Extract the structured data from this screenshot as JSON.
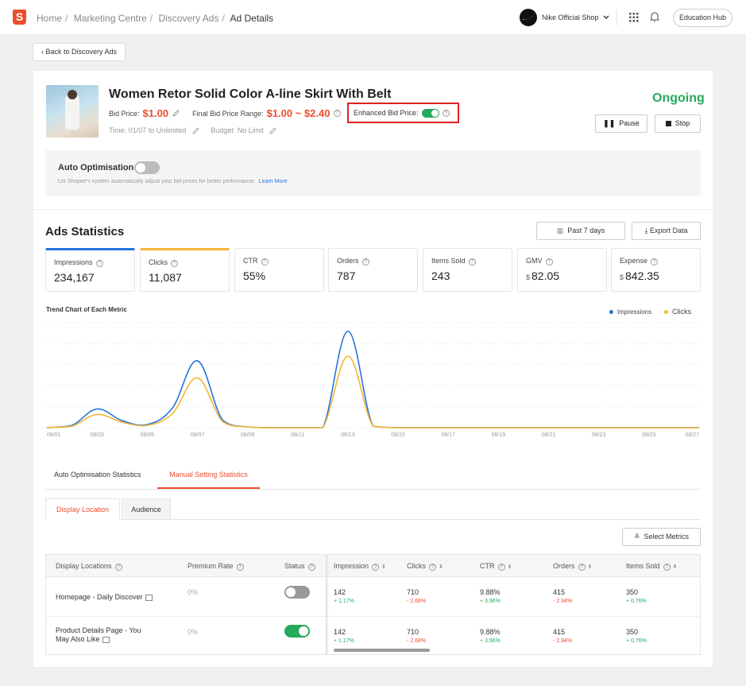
{
  "topbar": {
    "logo_letter": "S",
    "breadcrumb": [
      "Home",
      "Marketing Centre",
      "Discovery Ads",
      "Ad Details"
    ],
    "shop_name": "Nike Official Shop",
    "education_hub": "Education Hub"
  },
  "back_label": "Back to Discovery Ads",
  "product": {
    "title": "Women Retor Solid Color A-line Skirt With Belt",
    "bid_price_label": "Bid Price:",
    "bid_price": "$1.00",
    "final_range_label": "Final Bid Price Range:",
    "final_range": "$1.00 ~ $2.40",
    "enhanced_label": "Enhanced Bid Price:",
    "enhanced_on": true,
    "time": "Time: 01/07 to Unlimited",
    "budget": "Budget: No Limit",
    "status": "Ongoing",
    "pause_label": "Pause",
    "stop_label": "Stop"
  },
  "auto_opt": {
    "title": "Auto Optimisation",
    "enabled": false,
    "desc": "Let Shopee's system automatically adjust your bid prices for better performance.",
    "learn_more": "Learn More"
  },
  "stats": {
    "title": "Ads Statistics",
    "date_range": "Past 7 days",
    "export_label": "Export Data",
    "metrics": [
      {
        "label": "Impressions",
        "value": "234,167",
        "currency": ""
      },
      {
        "label": "Clicks",
        "value": "11,087",
        "currency": ""
      },
      {
        "label": "CTR",
        "value": "55%",
        "currency": ""
      },
      {
        "label": "Orders",
        "value": "787",
        "currency": ""
      },
      {
        "label": "Items Sold",
        "value": "243",
        "currency": ""
      },
      {
        "label": "GMV",
        "value": "82.05",
        "currency": "$"
      },
      {
        "label": "Expense",
        "value": "842.35",
        "currency": "$"
      }
    ],
    "trend_title": "Trend Chart of Each Metric"
  },
  "colors": {
    "impressions": "#2673dd",
    "clicks": "#f4b536",
    "accent": "#ee4d2d",
    "green": "#26aa5e"
  },
  "chart_data": {
    "type": "line",
    "x": [
      "08/01",
      "08/02",
      "08/03",
      "08/04",
      "08/05",
      "08/06",
      "08/07",
      "08/08",
      "08/09",
      "08/10",
      "08/11",
      "08/12",
      "08/13",
      "08/14",
      "08/15",
      "08/16",
      "08/17",
      "08/18",
      "08/19",
      "08/20",
      "08/21",
      "08/22",
      "08/23",
      "08/24",
      "08/25",
      "08/26",
      "08/27"
    ],
    "x_tick_labels": [
      "08/01",
      "08/03",
      "08/05",
      "08/07",
      "08/09",
      "08/11",
      "08/13",
      "08/15",
      "08/17",
      "08/19",
      "08/21",
      "08/23",
      "08/25",
      "08/27"
    ],
    "series": [
      {
        "name": "Impressions",
        "values": [
          0,
          3,
          24,
          9,
          4,
          25,
          86,
          10,
          1,
          0,
          0,
          0,
          124,
          2,
          0,
          0,
          0,
          0,
          0,
          0,
          0,
          0,
          0,
          0,
          0,
          0,
          0
        ]
      },
      {
        "name": "Clicks",
        "values": [
          0,
          2,
          17,
          7,
          3,
          18,
          64,
          8,
          1,
          0,
          0,
          0,
          92,
          2,
          0,
          0,
          0,
          0,
          0,
          0,
          0,
          0,
          0,
          0,
          0,
          0,
          0
        ]
      }
    ],
    "ylim": [
      0,
      135
    ],
    "grid": true,
    "legend": "top-right"
  },
  "tabs": [
    "Auto Optimisation Statistics",
    "Manual Setting Statistics"
  ],
  "subtabs": [
    "Display Location",
    "Audience"
  ],
  "select_metrics": "Select Metrics",
  "table": {
    "headers": [
      "Display Locations",
      "Premium Rate",
      "Status",
      "Impression",
      "Clicks",
      "CTR",
      "Orders",
      "Items Sold"
    ],
    "rows": [
      {
        "location": "Homepage - Daily Discover",
        "premium": "0%",
        "status_on": false,
        "impression": "142",
        "impression_delta": "+ 1.17%",
        "clicks": "710",
        "clicks_delta": "- 2.68%",
        "ctr": "9.88%",
        "ctr_delta": "+ 3.96%",
        "orders": "415",
        "orders_delta": "- 2.94%",
        "items_sold": "350",
        "items_sold_delta": "+ 0.76%"
      },
      {
        "location_line1": "Product Details Page - You",
        "location_line2": "May Also Like",
        "premium": "0%",
        "status_on": true,
        "impression": "142",
        "impression_delta": "+ 1.17%",
        "clicks": "710",
        "clicks_delta": "- 2.68%",
        "ctr": "9.88%",
        "ctr_delta": "+ 3.96%",
        "orders": "415",
        "orders_delta": "- 2.94%",
        "items_sold": "350",
        "items_sold_delta": "+ 0.76%"
      }
    ]
  }
}
